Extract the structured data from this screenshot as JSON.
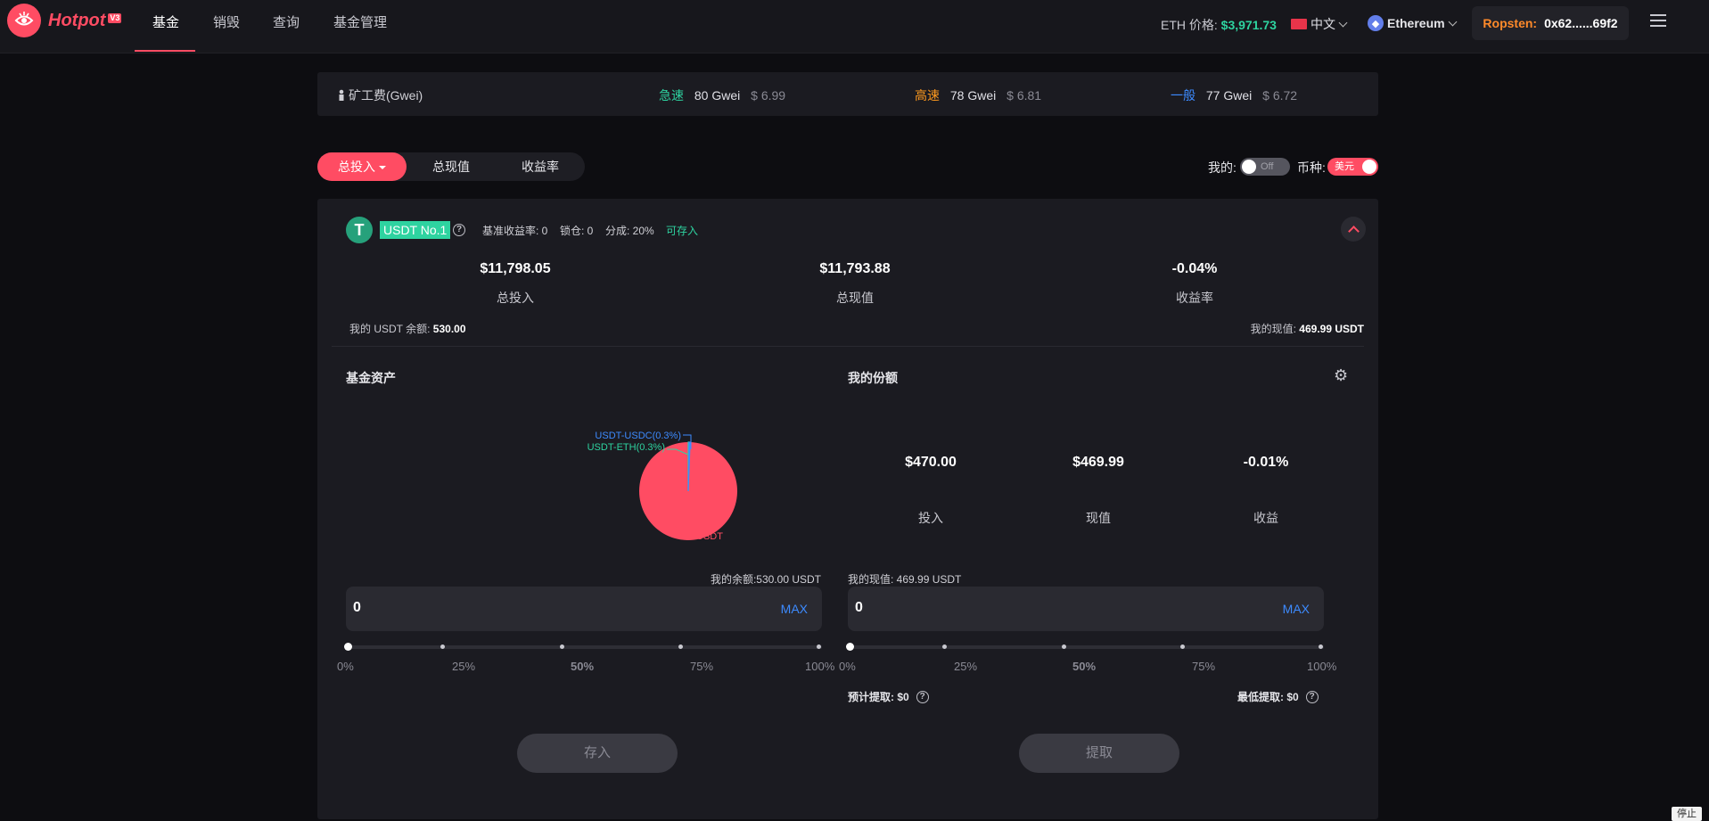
{
  "brand": {
    "name": "Hotpot",
    "badge": "V3"
  },
  "nav": {
    "items": [
      "基金",
      "销毁",
      "查询",
      "基金管理"
    ],
    "active": 0
  },
  "header": {
    "eth_price_label": "ETH 价格:",
    "eth_price_value": "$3,971.73",
    "language": "中文",
    "network": "Ethereum",
    "wallet_network": "Ropsten:",
    "wallet_address": "0x62......69f2"
  },
  "gas": {
    "title": "矿工费(Gwei)",
    "fast": {
      "label": "急速",
      "gwei": "80 Gwei",
      "usd": "$ 6.99",
      "color": "#2ed3a0"
    },
    "high": {
      "label": "高速",
      "gwei": "78 Gwei",
      "usd": "$ 6.81",
      "color": "#ff9a1f"
    },
    "normal": {
      "label": "一般",
      "gwei": "77 Gwei",
      "usd": "$ 6.72",
      "color": "#3d8bff"
    }
  },
  "tabs": [
    "总投入",
    "总现值",
    "收益率"
  ],
  "filters": {
    "mine_label": "我的:",
    "mine_switch": "Off",
    "currency_label": "币种:",
    "currency_switch": "美元"
  },
  "fund": {
    "name": "USDT No.1",
    "benchmark": "基准收益率: 0",
    "lock": "锁仓: 0",
    "share": "分成: 20%",
    "status": "可存入",
    "total_invest": "$11,798.05",
    "total_invest_label": "总投入",
    "total_value": "$11,793.88",
    "total_value_label": "总现值",
    "yield": "-0.04%",
    "yield_label": "收益率",
    "my_balance_label": "我的 USDT 余额:",
    "my_balance": "530.00",
    "my_value_label": "我的现值:",
    "my_value": "469.99 USDT"
  },
  "assets": {
    "title": "基金资产",
    "labels": {
      "usdc": "USDT-USDC(0.3%)",
      "eth": "USDT-ETH(0.3%)",
      "usdt": "USDT"
    }
  },
  "chart_data": {
    "type": "pie",
    "title": "基金资产",
    "slices": [
      {
        "label": "USDT",
        "value": 99.4,
        "color": "#ff4c63"
      },
      {
        "label": "USDT-ETH(0.3%)",
        "value": 0.3,
        "color": "#2ed3a0"
      },
      {
        "label": "USDT-USDC(0.3%)",
        "value": 0.3,
        "color": "#3d8bff"
      }
    ]
  },
  "my_share": {
    "title": "我的份额",
    "invest": "$470.00",
    "invest_label": "投入",
    "value": "$469.99",
    "value_label": "现值",
    "yield": "-0.01%",
    "yield_label": "收益"
  },
  "deposit": {
    "balance_line": "我的余额:530.00 USDT",
    "amount": "0",
    "max": "MAX",
    "button": "存入"
  },
  "withdraw": {
    "value_line": "我的现值: 469.99 USDT",
    "amount": "0",
    "max": "MAX",
    "button": "提取",
    "estimate": "预计提取:  $0",
    "minimum": "最低提取:  $0"
  },
  "slider_marks": [
    "0%",
    "25%",
    "50%",
    "75%",
    "100%"
  ],
  "slider_level": 0,
  "corner_badge": "停止"
}
